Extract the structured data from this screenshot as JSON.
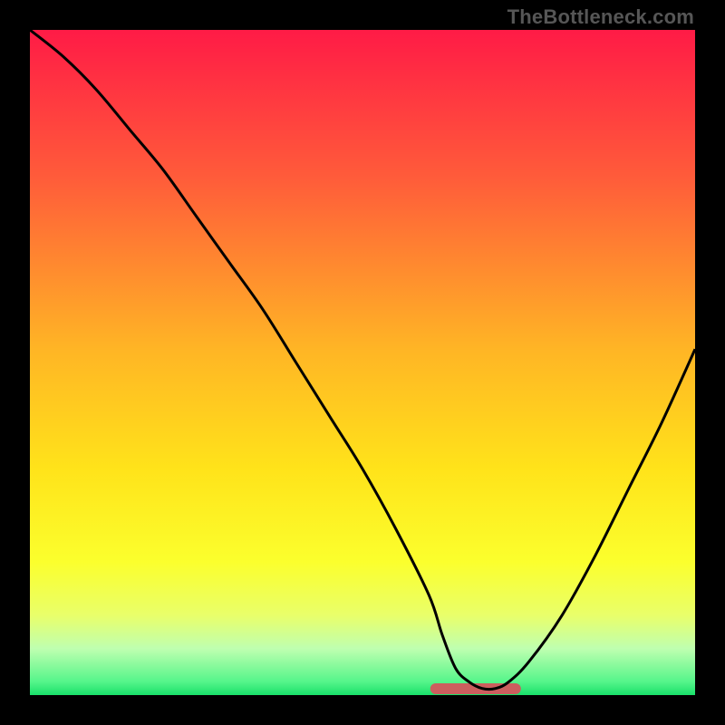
{
  "watermark": {
    "text": "TheBottleneck.com"
  },
  "chart_data": {
    "type": "line",
    "title": "",
    "xlabel": "",
    "ylabel": "",
    "xlim": [
      0,
      100
    ],
    "ylim": [
      0,
      100
    ],
    "grid": false,
    "legend": false,
    "background_gradient_stops": [
      {
        "pct": 0,
        "color": "#ff1b46"
      },
      {
        "pct": 22,
        "color": "#ff5b3a"
      },
      {
        "pct": 48,
        "color": "#ffb525"
      },
      {
        "pct": 66,
        "color": "#ffe31a"
      },
      {
        "pct": 80,
        "color": "#fbff2d"
      },
      {
        "pct": 88,
        "color": "#e9ff6a"
      },
      {
        "pct": 93,
        "color": "#bfffb0"
      },
      {
        "pct": 98,
        "color": "#55f58a"
      },
      {
        "pct": 100,
        "color": "#19e06a"
      }
    ],
    "series": [
      {
        "name": "bottleneck-curve",
        "x": [
          0,
          5,
          10,
          15,
          20,
          25,
          30,
          35,
          40,
          45,
          50,
          55,
          60,
          62,
          64,
          66,
          68,
          70,
          72,
          75,
          80,
          85,
          90,
          95,
          100
        ],
        "y": [
          100,
          96,
          91,
          85,
          79,
          72,
          65,
          58,
          50,
          42,
          34,
          25,
          15,
          9,
          4,
          2,
          1,
          1,
          2,
          5,
          12,
          21,
          31,
          41,
          52
        ]
      }
    ],
    "highlight_band": {
      "x_start": 61,
      "x_end": 73,
      "color": "#cc5e5e",
      "thickness": 12
    }
  }
}
